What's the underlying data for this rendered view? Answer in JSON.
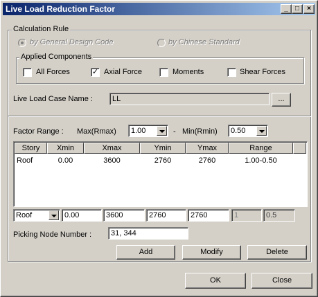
{
  "window": {
    "title": "Live Load Reduction Factor"
  },
  "calc_rule": {
    "legend": "Calculation Rule",
    "radio_general": "by General Design Code",
    "radio_chinese": "by Chinese Standard"
  },
  "components": {
    "legend": "Applied Components",
    "all_forces": "All Forces",
    "axial_force": "Axial Force",
    "moments": "Moments",
    "shear_forces": "Shear Forces"
  },
  "load_case": {
    "label": "Live Load Case Name :",
    "value": "LL",
    "browse": "..."
  },
  "factor": {
    "label": "Factor Range :",
    "max_label": "Max(Rmax)",
    "max_value": "1.00",
    "dash": "-",
    "min_label": "Min(Rmin)",
    "min_value": "0.50"
  },
  "table": {
    "headers": [
      "Story",
      "Xmin",
      "Xmax",
      "Ymin",
      "Ymax",
      "Range"
    ],
    "rows": [
      [
        "Roof",
        "0.00",
        "3600",
        "2760",
        "2760",
        "1.00-0.50"
      ]
    ]
  },
  "edit_row": {
    "story": "Roof",
    "xmin": "0.00",
    "xmax": "3600",
    "ymin": "2760",
    "ymax": "2760",
    "rmax": "1",
    "rmin": "0.5"
  },
  "picking": {
    "label": "Picking Node Number :",
    "value": "31, 344"
  },
  "buttons": {
    "add": "Add",
    "modify": "Modify",
    "delete": "Delete",
    "ok": "OK",
    "close": "Close"
  },
  "checkmark": "✓"
}
